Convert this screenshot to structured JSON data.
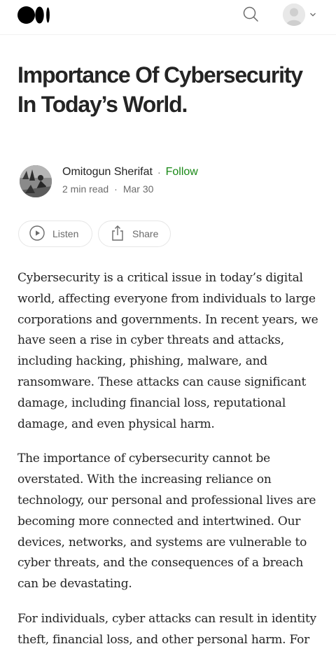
{
  "header": {
    "logo_icon": "medium-logo-icon",
    "search_icon": "search-icon",
    "profile_icon": "avatar-icon",
    "chevron_icon": "chevron-down-icon"
  },
  "article": {
    "title": "Importance Of Cybersecurity In Today’s World.",
    "author": {
      "name": "Omitogun Sherifat",
      "separator": "·",
      "follow_label": "Follow",
      "read_time": "2 min read",
      "date_separator": "·",
      "date": "Mar 30"
    },
    "actions": {
      "listen_label": "Listen",
      "share_label": "Share"
    },
    "paragraphs": [
      "Cybersecurity is a critical issue in today’s digital world, affecting everyone from individuals to large corporations and governments. In recent years, we have seen a rise in cyber threats and attacks, including hacking, phishing, malware, and ransomware. These attacks can cause significant damage, including financial loss, reputational damage, and even physical harm.",
      "The importance of cybersecurity cannot be overstated. With the increasing reliance on technology, our personal and professional lives are becoming more connected and intertwined. Our devices, networks, and systems are vulnerable to cyber threats, and the consequences of a breach can be devastating.",
      "For individuals, cyber attacks can result in identity theft, financial loss, and other personal harm. For"
    ]
  },
  "colors": {
    "text": "#242424",
    "muted": "#6b6b6b",
    "accent": "#1a8917",
    "border": "#e6e6e6"
  }
}
